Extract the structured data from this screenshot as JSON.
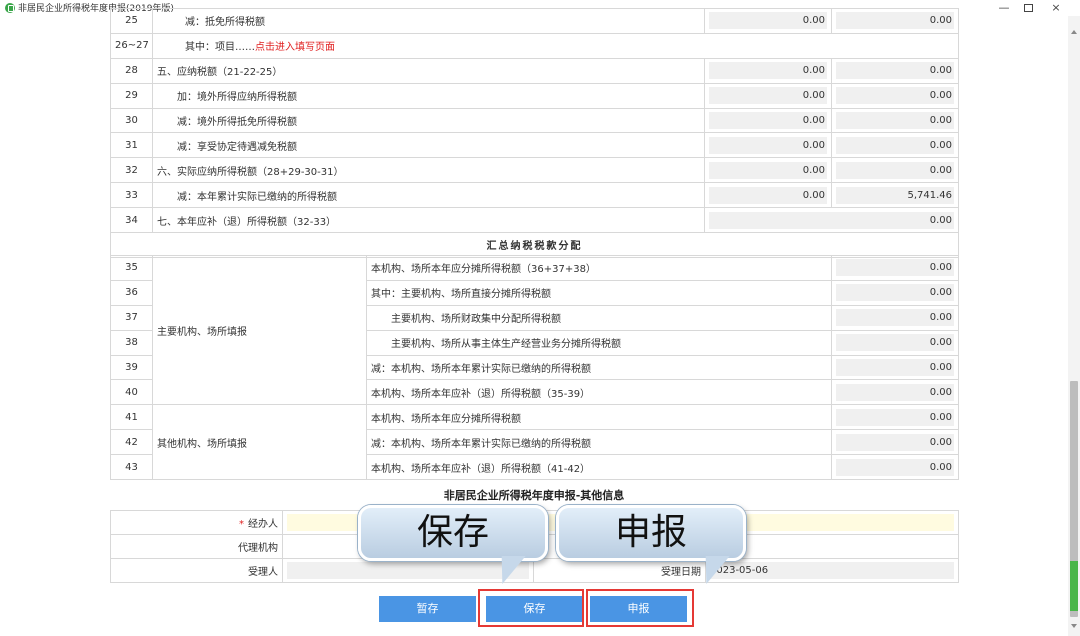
{
  "window": {
    "title": "非居民企业所得税年度申报(2019年版)",
    "min_glyph": "—",
    "close_glyph": "×"
  },
  "rows": [
    {
      "num": "25",
      "item": "减：抵免所得税额",
      "v1": "0.00",
      "v2": "0.00"
    },
    {
      "num": "26~27",
      "item": "其中：项目……",
      "link": "点击进入填写页面"
    },
    {
      "num": "28",
      "item": "五、应纳税额（21-22-25）",
      "v1": "0.00",
      "v2": "0.00"
    },
    {
      "num": "29",
      "item": "加：境外所得应纳所得税额",
      "v1": "0.00",
      "v2": "0.00"
    },
    {
      "num": "30",
      "item": "减：境外所得抵免所得税额",
      "v1": "0.00",
      "v2": "0.00"
    },
    {
      "num": "31",
      "item": "减：享受协定待遇减免税额",
      "v1": "0.00",
      "v2": "0.00"
    },
    {
      "num": "32",
      "item": "六、实际应纳所得税额（28+29-30-31）",
      "v1": "0.00",
      "v2": "0.00"
    },
    {
      "num": "33",
      "item": "减：本年累计实际已缴纳的所得税额",
      "v1": "0.00",
      "v2": "5,741.46"
    },
    {
      "num": "34",
      "item": "七、本年应补（退）所得税额（32-33）",
      "v2": "0.00"
    }
  ],
  "section_title": "汇总纳税税款分配",
  "group_main_label": "主要机构、场所填报",
  "group_other_label": "其他机构、场所填报",
  "alloc_rows": [
    {
      "num": "35",
      "item": "本机构、场所本年应分摊所得税额（36+37+38）",
      "v": "0.00"
    },
    {
      "num": "36",
      "item": "其中：主要机构、场所直接分摊所得税额",
      "v": "0.00"
    },
    {
      "num": "37",
      "item": "主要机构、场所财政集中分配所得税额",
      "v": "0.00"
    },
    {
      "num": "38",
      "item": "主要机构、场所从事主体生产经营业务分摊所得税额",
      "v": "0.00"
    },
    {
      "num": "39",
      "item": "减：本机构、场所本年累计实际已缴纳的所得税额",
      "v": "0.00"
    },
    {
      "num": "40",
      "item": "本机构、场所本年应补（退）所得税额（35-39）",
      "v": "0.00"
    },
    {
      "num": "41",
      "item": "本机构、场所本年应分摊所得税额",
      "v": "0.00"
    },
    {
      "num": "42",
      "item": "减：本机构、场所本年累计实际已缴纳的所得税额",
      "v": "0.00"
    },
    {
      "num": "43",
      "item": "本机构、场所本年应补（退）所得税额（41-42）",
      "v": "0.00"
    }
  ],
  "info": {
    "title": "非居民企业所得税年度申报-其他信息",
    "required_mark": "*",
    "handler_label": "经办人",
    "agency_label": "代理机构",
    "receiver_label": "受理人",
    "receive_date_label": "受理日期",
    "receive_date_value": "2023-05-06"
  },
  "buttons": {
    "draft": "暂存",
    "save": "保存",
    "submit": "申报"
  },
  "callouts": {
    "save": "保存",
    "submit": "申报"
  },
  "colors": {
    "button_blue": "#4a95e4",
    "highlight_red": "#e53935",
    "link_red": "#e02020"
  }
}
